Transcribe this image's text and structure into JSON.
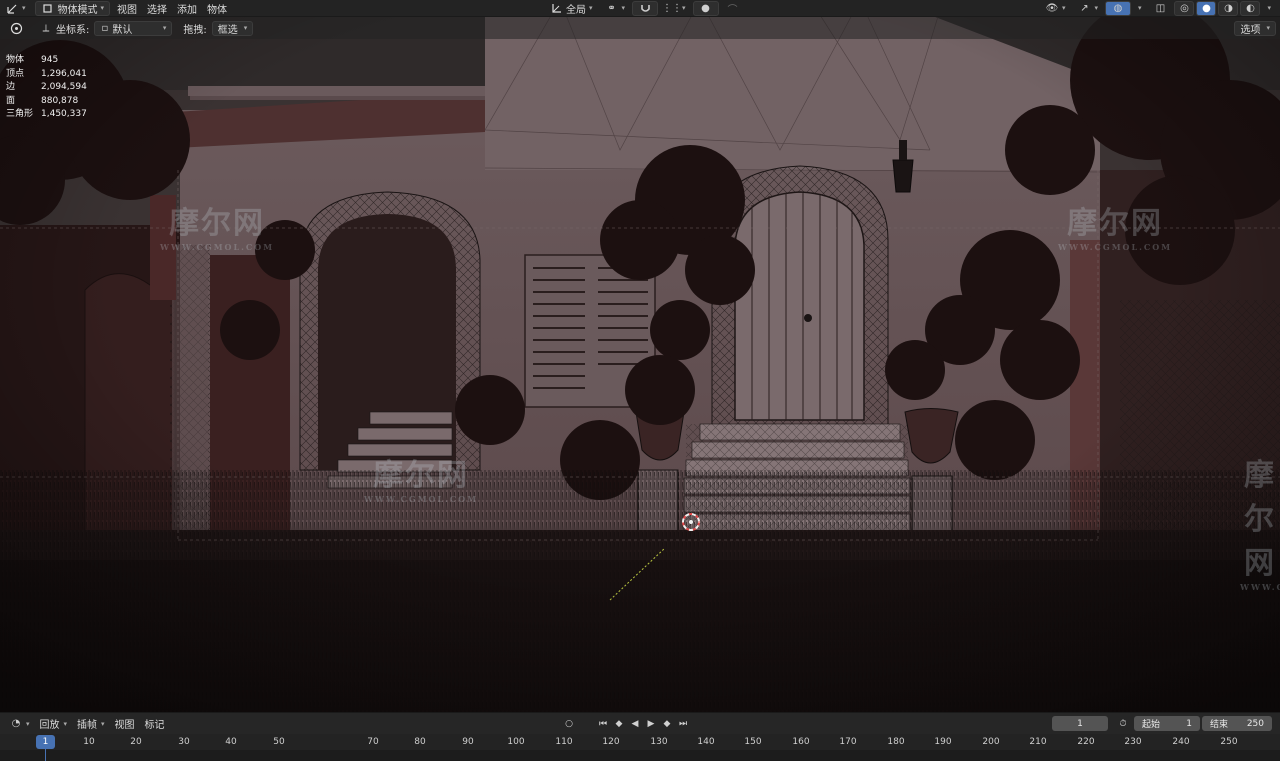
{
  "header": {
    "editor_type_icon": "transform-gizmo-icon",
    "mode": "物体模式",
    "menus": [
      "视图",
      "选择",
      "添加",
      "物体"
    ],
    "orientation_label": "坐标系:",
    "orientation_value": "默认",
    "drag_label": "拖拽:",
    "drag_value": "框选",
    "pivot_value": "全局",
    "options_label": "选项"
  },
  "stats": [
    {
      "label": "物体",
      "value": "945"
    },
    {
      "label": "顶点",
      "value": "1,296,041"
    },
    {
      "label": "边",
      "value": "2,094,594"
    },
    {
      "label": "面",
      "value": "880,878"
    },
    {
      "label": "三角形",
      "value": "1,450,337"
    }
  ],
  "watermark": {
    "main": "摩尔网",
    "sub": "WWW.CGMOL.COM"
  },
  "timeline": {
    "menus": [
      "回放",
      "插帧",
      "视图",
      "标记"
    ],
    "current_frame": "1",
    "start_label": "起始",
    "start_value": "1",
    "end_label": "结束",
    "end_value": "250",
    "ruler": [
      "1",
      "10",
      "20",
      "30",
      "40",
      "50",
      "70",
      "80",
      "90",
      "100",
      "110",
      "120",
      "130",
      "140",
      "150",
      "160",
      "170",
      "180",
      "190",
      "200",
      "210",
      "220",
      "230",
      "240",
      "250"
    ]
  },
  "colors": {
    "accent": "#4772b3",
    "viewport_bg": "#2a2222",
    "wall": "#6e5a5c"
  }
}
